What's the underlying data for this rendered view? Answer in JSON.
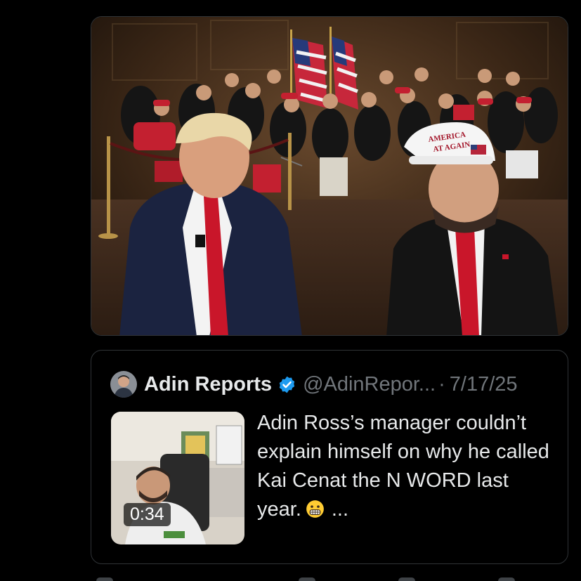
{
  "tweet": {
    "quote": {
      "author_name": "Adin Reports",
      "handle": "@AdinRepor...",
      "separator": "·",
      "date": "7/17/25",
      "verified_icon": "verified-badge-icon",
      "video_duration": "0:34",
      "text": "Adin Ross’s manager couldn’t explain himself on why he called Kai Cenat the N WORD last year.",
      "emoji_icon": "grimacing-face-icon",
      "more_indicator": "..."
    }
  },
  "colors": {
    "background": "#000000",
    "border": "#2f3336",
    "text_primary": "#e7e9ea",
    "text_secondary": "#71767b",
    "verified_blue": "#1d9bf0"
  }
}
